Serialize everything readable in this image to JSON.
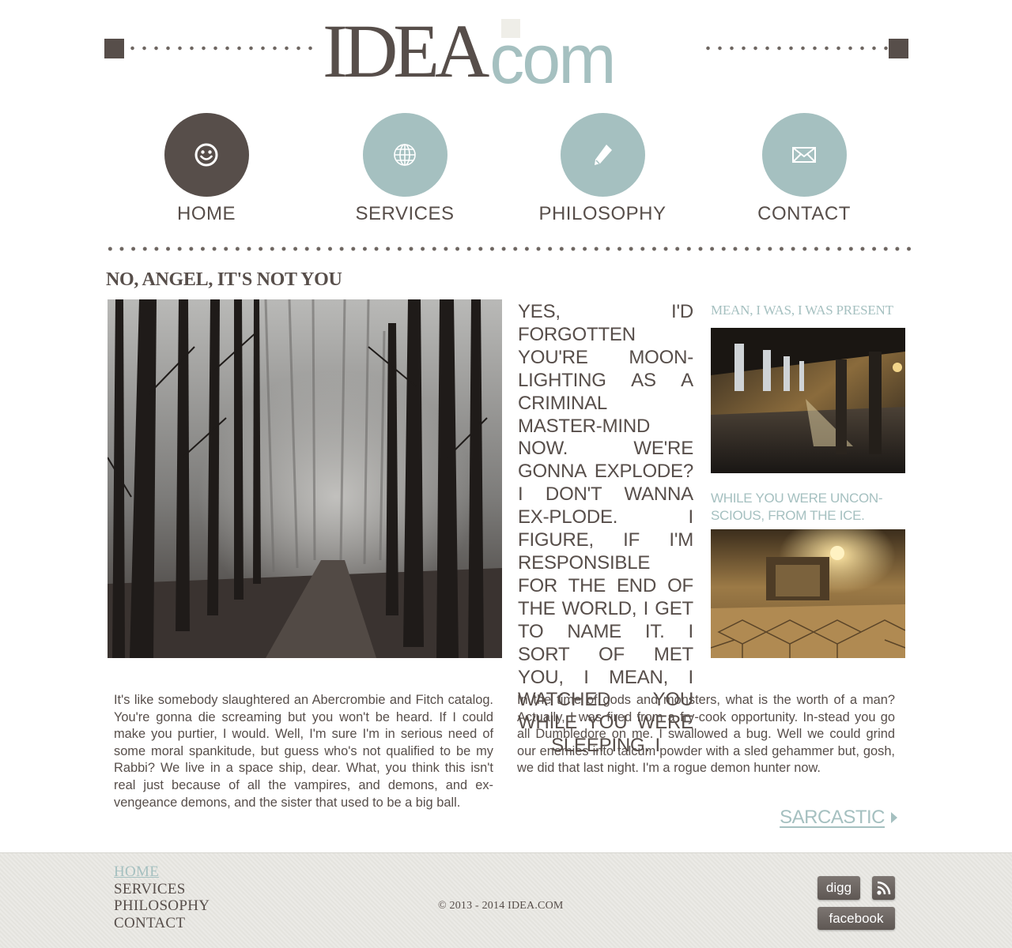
{
  "logo": {
    "brand": "IDEA",
    "suffix": "com"
  },
  "nav": [
    {
      "label": "HOME",
      "icon": "smiley-icon",
      "active": true
    },
    {
      "label": "SERVICES",
      "icon": "globe-icon",
      "active": false
    },
    {
      "label": "PHILOSOPHY",
      "icon": "pencil-icon",
      "active": false
    },
    {
      "label": "CONTACT",
      "icon": "envelope-icon",
      "active": false
    }
  ],
  "main": {
    "title": "NO, ANGEL, IT'S NOT YOU",
    "feature_text": "YES, I'D FORGOTTEN YOU'RE MOON-LIGHTING AS A CRIMINAL MASTER-MIND NOW. WE'RE GONNA EXPLODE? I DON'T WANNA EX-PLODE. I FIGURE, IF I'M RESPONSIBLE FOR THE END OF THE WORLD, I GET TO NAME IT. I SORT OF MET YOU, I MEAN, I WATCHED YOU WHILE YOU WERE SLEEPING. I",
    "side_title_1": "MEAN, I WAS, I WAS PRESENT",
    "side_title_2": "WHILE YOU WERE UNCON-SCIOUS, FROM THE ICE.",
    "body_left": "It's like somebody slaughtered an Abercrombie and Fitch catalog. You're gonna die screaming but you won't be heard. If I could make you purtier, I would. Well, I'm sure I'm in serious need of some moral spankitude, but guess who's not qualified to be my Rabbi? We live in a space ship, dear. What, you think this isn't real just because of all the vampires, and demons, and ex-vengeance demons, and the sister that used to be a big ball.",
    "body_right": "In the time of gods and monsters, what is the worth of a man? Actually, I was fired from a fry-cook opportunity. In-stead you go all Dumbledore on me. I swallowed a bug. Well we could grind our enemies into talcum powder with a sled gehammer but, gosh, we did that last night. I'm a rogue demon hunter now.",
    "more_link": "SARCASTIC"
  },
  "footer": {
    "nav": [
      {
        "label": "HOME",
        "active": true
      },
      {
        "label": "SERVICES",
        "active": false
      },
      {
        "label": "PHILOSOPHY",
        "active": false
      },
      {
        "label": "CONTACT",
        "active": false
      }
    ],
    "copyright": "© 2013 - 2014 IDEA.COM",
    "social": {
      "digg": "digg",
      "facebook": "facebook",
      "rss_icon": "rss-icon"
    }
  },
  "colors": {
    "dark": "#574e4a",
    "accent": "#a5c0c0",
    "footer_bg": "#e4e3de"
  }
}
